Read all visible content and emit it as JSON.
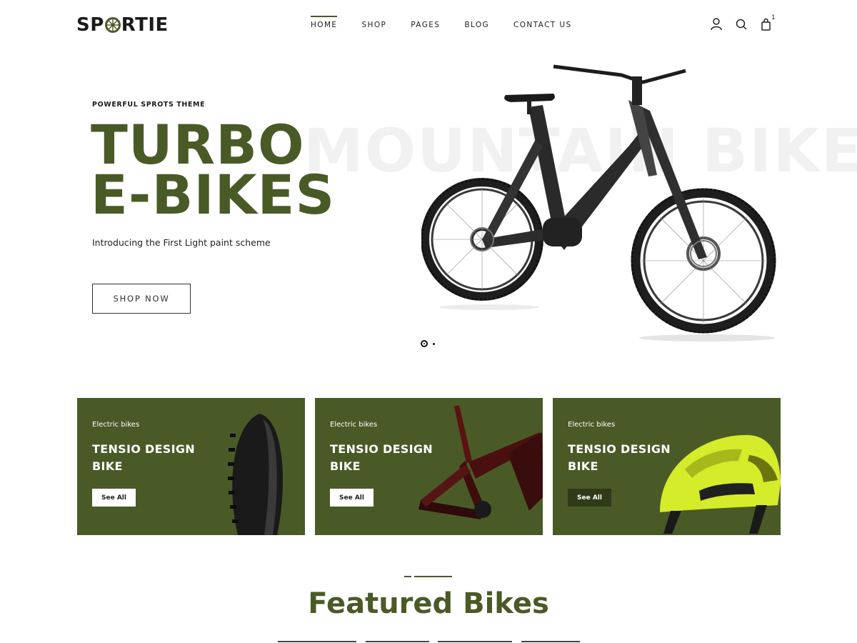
{
  "header": {
    "logo_text_before": "SP",
    "logo_text_after": "RTIE",
    "nav": [
      {
        "label": "HOME",
        "active": true
      },
      {
        "label": "SHOP",
        "active": false
      },
      {
        "label": "PAGES",
        "active": false
      },
      {
        "label": "BLOG",
        "active": false
      },
      {
        "label": "CONTACT US",
        "active": false
      }
    ],
    "icons": [
      "user-icon",
      "search-icon",
      "bag-icon"
    ],
    "cart_count": "1"
  },
  "hero": {
    "subtitle": "POWERFUL SPROTS THEME",
    "background_word": "MOUNTAIN BIKE",
    "title_line1": "TURBO",
    "title_line2": "E-BIKES",
    "description": "Introducing the First Light paint scheme",
    "button_label": "SHOP NOW",
    "slides": 2,
    "active_slide": 1
  },
  "categories": [
    {
      "category": "Electric bikes",
      "title_line1": "TENSIO DESIGN",
      "title_line2": "BIKE",
      "button": "See All",
      "image": "tire-image"
    },
    {
      "category": "Electric bikes",
      "title_line1": "TENSIO DESIGN",
      "title_line2": "BIKE",
      "button": "See All",
      "image": "bike-frame-image"
    },
    {
      "category": "Electric bikes",
      "title_line1": "TENSIO DESIGN",
      "title_line2": "BIKE",
      "button": "See All",
      "image": "helmet-image"
    }
  ],
  "featured": {
    "title": "Featured Bikes"
  },
  "colors": {
    "accent": "#4a5a27",
    "accent_dark": "#2f3b18",
    "helmet": "#d4ec2a"
  }
}
